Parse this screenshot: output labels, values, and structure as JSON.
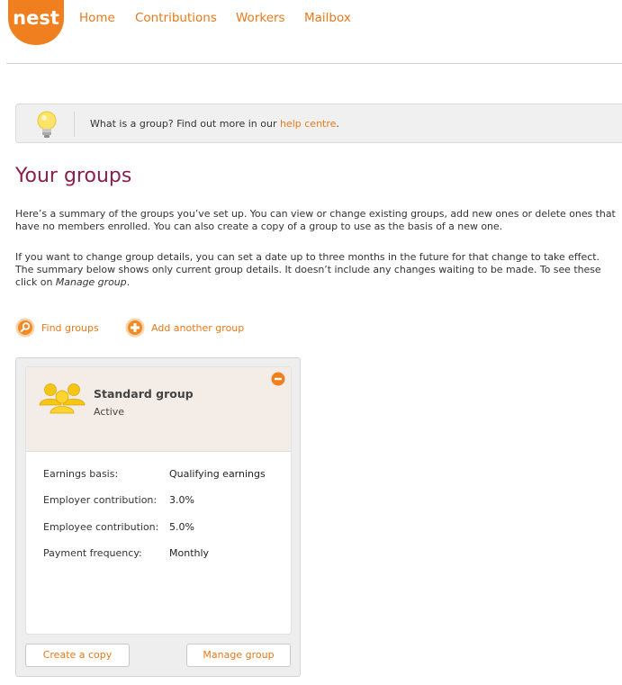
{
  "brand": {
    "logo_text": "nest",
    "accent": "#e8791b",
    "title_color": "#8a1f4f"
  },
  "nav": [
    "Home",
    "Contributions",
    "Workers",
    "Mailbox"
  ],
  "tip": {
    "text_before": "What is a group? Find out more in our ",
    "link": "help centre",
    "text_after": ".",
    "icon": "lightbulb-icon"
  },
  "page": {
    "title": "Your groups",
    "para1": "Here’s a summary of the groups you’ve set up. You can view or change existing groups, add new ones or delete ones that have no members enrolled. You can also create a copy of a group to use as the basis of a new one.",
    "para2_main": "If you want to change group details, you can set a date up to three months in the future for that change to take effect. The summary below shows only current group details. It doesn’t include any changes waiting to be made. To see these click on ",
    "para2_em": "Manage group",
    "para2_end": "."
  },
  "actions": {
    "find": "Find groups",
    "add": "Add another group"
  },
  "group": {
    "name": "Standard group",
    "status": "Active",
    "details": [
      {
        "label": "Earnings basis:",
        "value": "Qualifying earnings"
      },
      {
        "label": "Employer contribution:",
        "value": "3.0%"
      },
      {
        "label": "Employee contribution:",
        "value": "5.0%"
      },
      {
        "label": "Payment frequency:",
        "value": "Monthly"
      }
    ],
    "copy_button": "Create a copy",
    "manage_button": "Manage group"
  }
}
